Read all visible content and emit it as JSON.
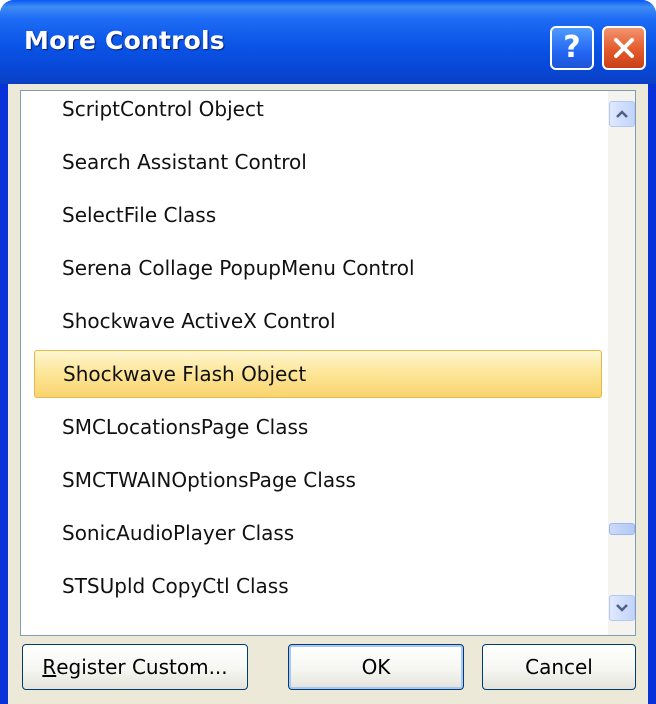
{
  "window": {
    "title": "More Controls"
  },
  "list": {
    "items": [
      "ScriptControl Object",
      "Search Assistant Control",
      "SelectFile Class",
      "Serena Collage PopupMenu Control",
      "Shockwave ActiveX Control",
      "Shockwave Flash Object",
      "SMCLocationsPage Class",
      "SMCTWAINOptionsPage Class",
      "SonicAudioPlayer Class",
      "STSUpld CopyCtl Class"
    ],
    "selected": "Shockwave Flash Object"
  },
  "buttons": {
    "register_first": "R",
    "register_rest": "egister Custom...",
    "ok": "OK",
    "cancel": "Cancel"
  },
  "colors": {
    "titlebar": "#0a54e6",
    "selection": "#fde79a",
    "dialog_bg": "#ece9d8"
  },
  "icons": {
    "help": "help-icon",
    "close": "close-icon",
    "scroll_up": "chevron-up-icon",
    "scroll_down": "chevron-down-icon"
  }
}
